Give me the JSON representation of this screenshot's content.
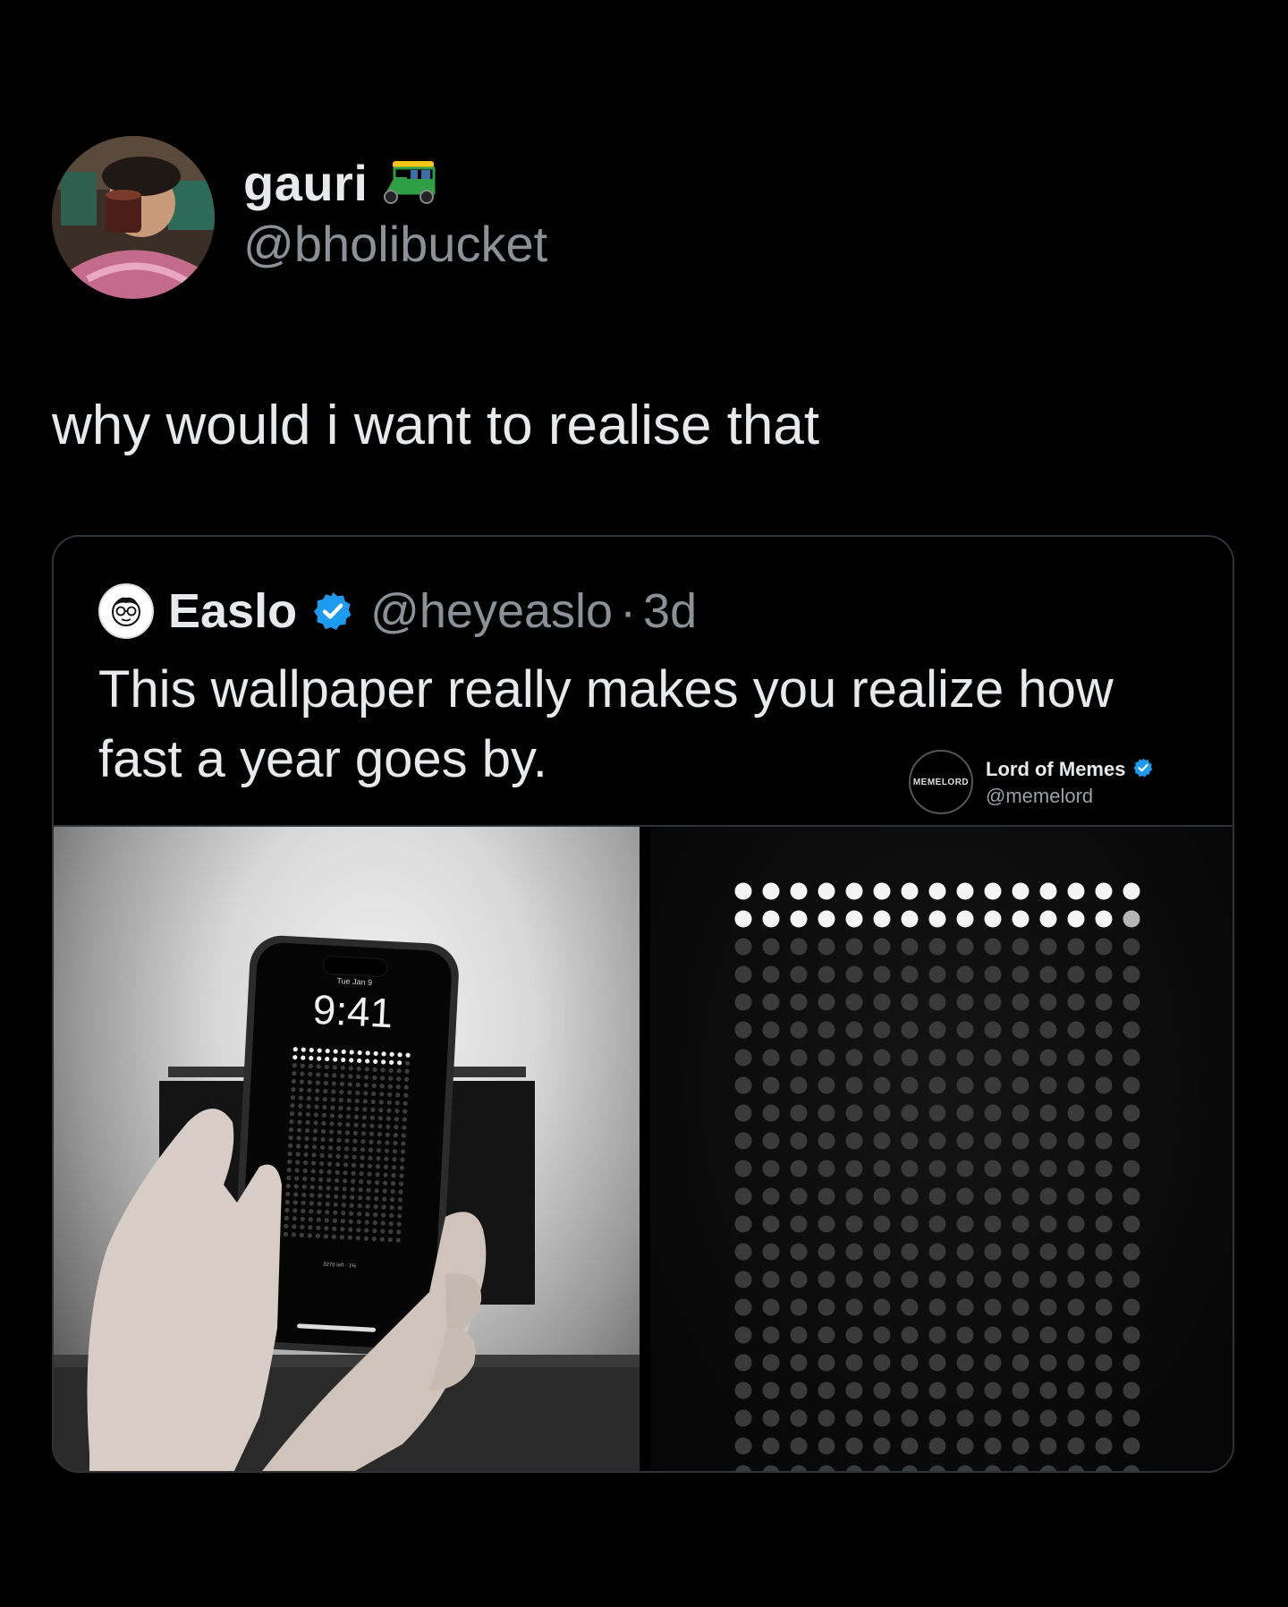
{
  "tweet": {
    "author": {
      "display_name": "gauri",
      "handle": "@bholibucket",
      "name_emoji_icon": "auto-rickshaw-icon"
    },
    "text": "why would i want to realise that"
  },
  "quoted_tweet": {
    "author": {
      "display_name": "Easlo",
      "handle": "@heyeaslo",
      "time_sep": "·",
      "age": "3d",
      "verified": true
    },
    "text": "This wallpaper really makes you realize how fast a year goes by."
  },
  "watermark": {
    "logo_text": "MEMELORD",
    "name": "Lord of Memes",
    "handle": "@memelord",
    "verified": true
  },
  "media": {
    "phone": {
      "date": "Tue Jan 9",
      "time": "9:41",
      "footer": "327d left · 1%"
    },
    "year_grid": {
      "columns": 15,
      "rows_visible": 22,
      "days_filled": 29
    }
  },
  "colors": {
    "background": "#000000",
    "text_primary": "#e7e9ea",
    "text_secondary": "#8b9197",
    "border": "#2f3336",
    "verified_blue": "#1d9bf0",
    "rickshaw_green": "#2f9e44",
    "rickshaw_yellow": "#f5c518"
  }
}
